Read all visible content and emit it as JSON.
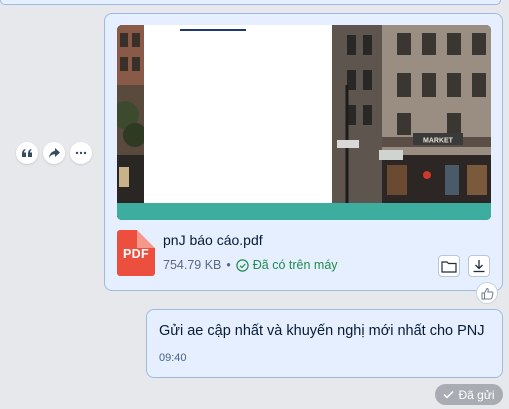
{
  "chat": {
    "file_message": {
      "file_name": "pnJ báo cáo.pdf",
      "file_type_label": "PDF",
      "file_size": "754.79 KB",
      "separator": "•",
      "download_status": "Đã có trên máy",
      "preview_sign_text": "MARKET"
    },
    "text_message": {
      "text": "Gửi ae cập nhất và khuyến nghị mới nhất cho PNJ",
      "time": "09:40"
    },
    "delivery_status": "Đã gửi"
  },
  "icons": {
    "quote": "quote-icon",
    "share": "share-icon",
    "more": "more-icon",
    "open_folder": "folder-icon",
    "download": "download-icon",
    "like": "thumbs-up-icon",
    "status": "check-circle-icon",
    "sent": "check-icon"
  },
  "colors": {
    "bubble_bg": "#e5efff",
    "bubble_border": "#9dbbe0",
    "pdf_red": "#ec4f3e",
    "status_green": "#208b4c",
    "teal_accent": "#3dada0"
  }
}
